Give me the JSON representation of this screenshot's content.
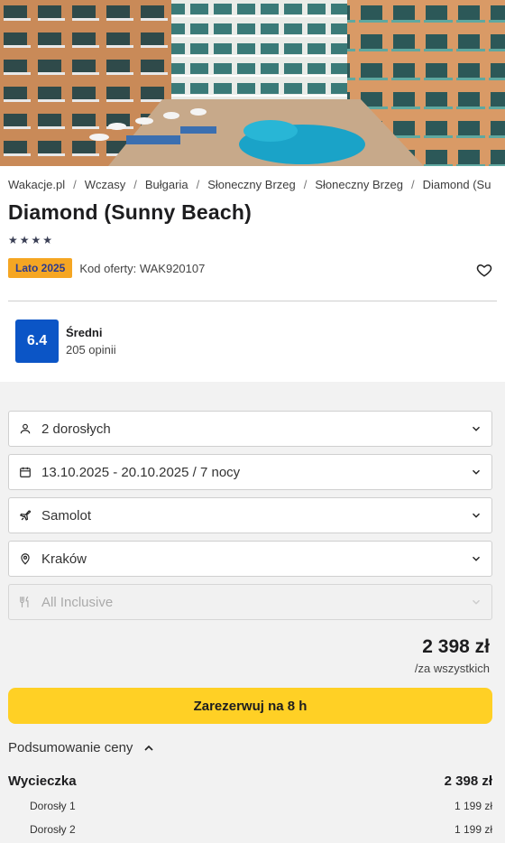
{
  "hero": {
    "alt": "Hotel pool photo"
  },
  "breadcrumbs": [
    "Wakacje.pl",
    "Wczasy",
    "Bułgaria",
    "Słoneczny Brzeg",
    "Słoneczny Brzeg",
    "Diamond (Su"
  ],
  "hotel": {
    "name": "Diamond (Sunny Beach)",
    "stars": "★★★★",
    "season_badge": "Lato 2025",
    "offer_code": "Kod oferty: WAK920107"
  },
  "rating": {
    "score": "6.4",
    "label": "Średni",
    "count": "205 opinii"
  },
  "form": {
    "people": "2 dorosłych",
    "dates": "13.10.2025 - 20.10.2025 / 7 nocy",
    "transport": "Samolot",
    "departure": "Kraków",
    "board": "All Inclusive"
  },
  "price": {
    "amount": "2 398 zł",
    "subtitle": "/za wszystkich"
  },
  "reserve_label": "Zarezerwuj na 8 h",
  "summary": {
    "toggle_label": "Podsumowanie ceny",
    "trip_label": "Wycieczka",
    "trip_value": "2 398 zł",
    "items": [
      {
        "label": "Dorosły 1",
        "value": "1 199 zł"
      },
      {
        "label": "Dorosły 2",
        "value": "1 199 zł"
      }
    ]
  },
  "colors": {
    "accent_yellow": "#ffd025",
    "season_badge": "#f5a623",
    "rating_blue": "#0b55c6"
  }
}
